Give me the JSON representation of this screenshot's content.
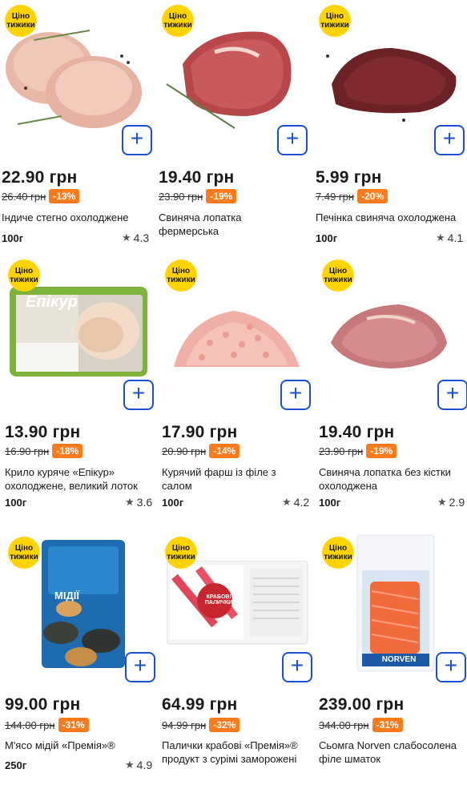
{
  "badge_text": "Ціно тижики",
  "add_symbol": "+",
  "star_symbol": "★",
  "colors": {
    "accent": "#1a4fd6",
    "badge": "#ffd400",
    "discount": "#ff7a1a"
  },
  "products": [
    {
      "price": "22.90 грн",
      "old_price": "26.40 грн",
      "discount": "-13%",
      "title_l1": "Індиче стегно охолоджене",
      "title_l2": "",
      "weight": "100г",
      "rating": "4.3"
    },
    {
      "price": "19.40 грн",
      "old_price": "23.90 грн",
      "discount": "-19%",
      "title_l1": "Свиняча лопатка",
      "title_l2": "фермерська",
      "weight": "",
      "rating": ""
    },
    {
      "price": "5.99 грн",
      "old_price": "7.49 грн",
      "discount": "-20%",
      "title_l1": "Печінка свиняча охолоджена",
      "title_l2": "",
      "weight": "100г",
      "rating": "4.1"
    },
    {
      "price": "13.90 грн",
      "old_price": "16.90 грн",
      "discount": "-18%",
      "title_l1": "Крило куряче «Епікур»",
      "title_l2": "охолоджене, великий лоток",
      "weight": "100г",
      "rating": "3.6"
    },
    {
      "price": "17.90 грн",
      "old_price": "20.90 грн",
      "discount": "-14%",
      "title_l1": "Курячий фарш із філе з",
      "title_l2": "салом",
      "weight": "100г",
      "rating": "4.2"
    },
    {
      "price": "19.40 грн",
      "old_price": "23.90 грн",
      "discount": "-19%",
      "title_l1": "Свиняча лопатка без кістки",
      "title_l2": "охолоджена",
      "weight": "100г",
      "rating": "2.9"
    },
    {
      "price": "99.00 грн",
      "old_price": "144.00 грн",
      "discount": "-31%",
      "title_l1": "М'ясо мідій «Премія»®",
      "title_l2": "",
      "weight": "250г",
      "rating": "4.9"
    },
    {
      "price": "64.99 грн",
      "old_price": "94.99 грн",
      "discount": "-32%",
      "title_l1": "Палички крабові «Премія»®",
      "title_l2": "продукт з сурімі заморожені",
      "weight": "",
      "rating": ""
    },
    {
      "price": "239.00 грн",
      "old_price": "344.00 грн",
      "discount": "-31%",
      "title_l1": "Сьомга Norven слабосолена",
      "title_l2": "філе шматок",
      "weight": "",
      "rating": ""
    }
  ],
  "package_text": {
    "epikur_brand": "Епікур",
    "mussel_brand": "МІДІЇ",
    "crab_brand": "КРАБОВІ ПАЛИЧКИ",
    "salmon_brand": "NORVEN"
  }
}
